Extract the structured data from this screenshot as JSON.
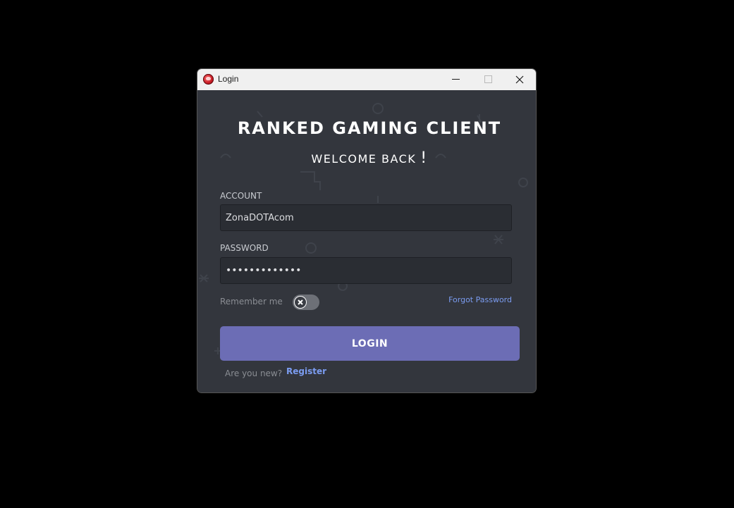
{
  "window": {
    "title": "Login"
  },
  "header": {
    "title": "RANKED GAMING CLIENT",
    "subtitle": "WELCOME BACK",
    "subtitle_punct": "!"
  },
  "form": {
    "account_label": "ACCOUNT",
    "account_value": "ZonaDOTAcom",
    "password_label": "PASSWORD",
    "password_value": "•••••••••••••",
    "remember_label": "Remember me",
    "remember_checked": false,
    "forgot_label": "Forgot Password",
    "login_label": "LOGIN",
    "new_prompt": "Are you new?",
    "register_label": "Register"
  },
  "colors": {
    "accent": "#6c6db5",
    "link": "#7b9cf0",
    "background": "#33363d",
    "input_bg": "#2a2d33"
  },
  "icons": [
    "app-icon",
    "minimize-icon",
    "maximize-icon",
    "close-icon",
    "toggle-off-icon"
  ]
}
